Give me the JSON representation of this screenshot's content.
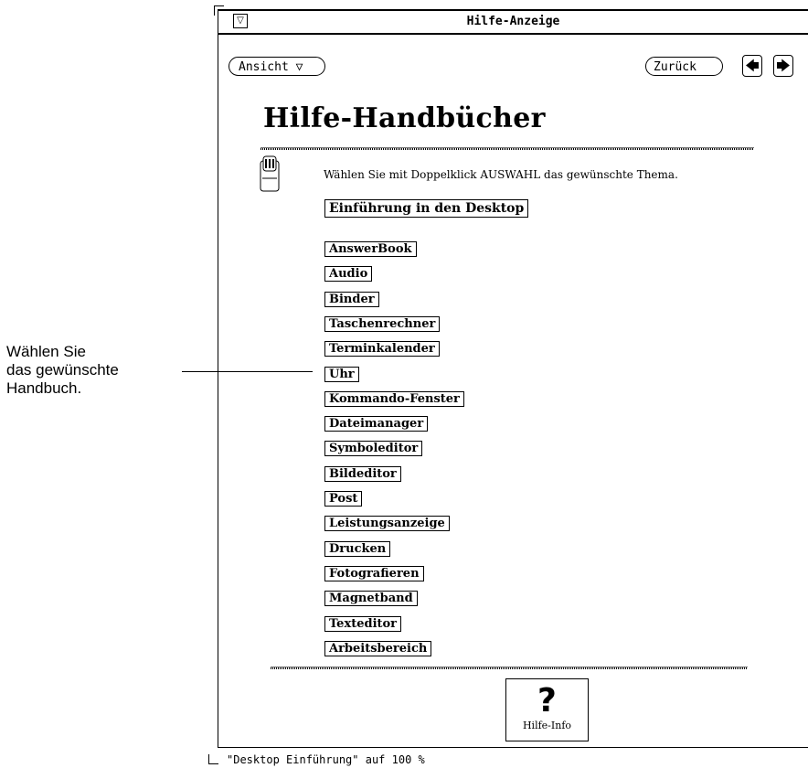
{
  "callout": {
    "line1": "Wählen Sie",
    "line2": "das gewünschte",
    "line3": "Handbuch."
  },
  "window": {
    "title": "Hilfe-Anzeige",
    "menu_glyph": "▽"
  },
  "toolbar": {
    "view_label": "Ansicht ▽",
    "back_label": "Zurück",
    "prev_glyph": "🡄",
    "next_glyph": "🡆"
  },
  "content": {
    "heading": "Hilfe-Handbücher",
    "instruction": "Wählen Sie mit Doppelklick AUSWAHL das gewünschte Thema.",
    "intro_item": "Einführung in den Desktop",
    "items": [
      "AnswerBook",
      "Audio",
      "Binder",
      "Taschenrechner",
      "Terminkalender",
      "Uhr",
      "Kommando-Fenster",
      "Dateimanager",
      "Symboleditor",
      "Bildeditor",
      "Post",
      "Leistungsanzeige",
      "Drucken",
      "Fotografieren",
      "Magnetband",
      "Texteditor",
      "Arbeitsbereich"
    ]
  },
  "help_info": {
    "glyph": "?",
    "label": "Hilfe-Info"
  },
  "status": {
    "text": "\"Desktop Einführung\" auf 100 %"
  }
}
